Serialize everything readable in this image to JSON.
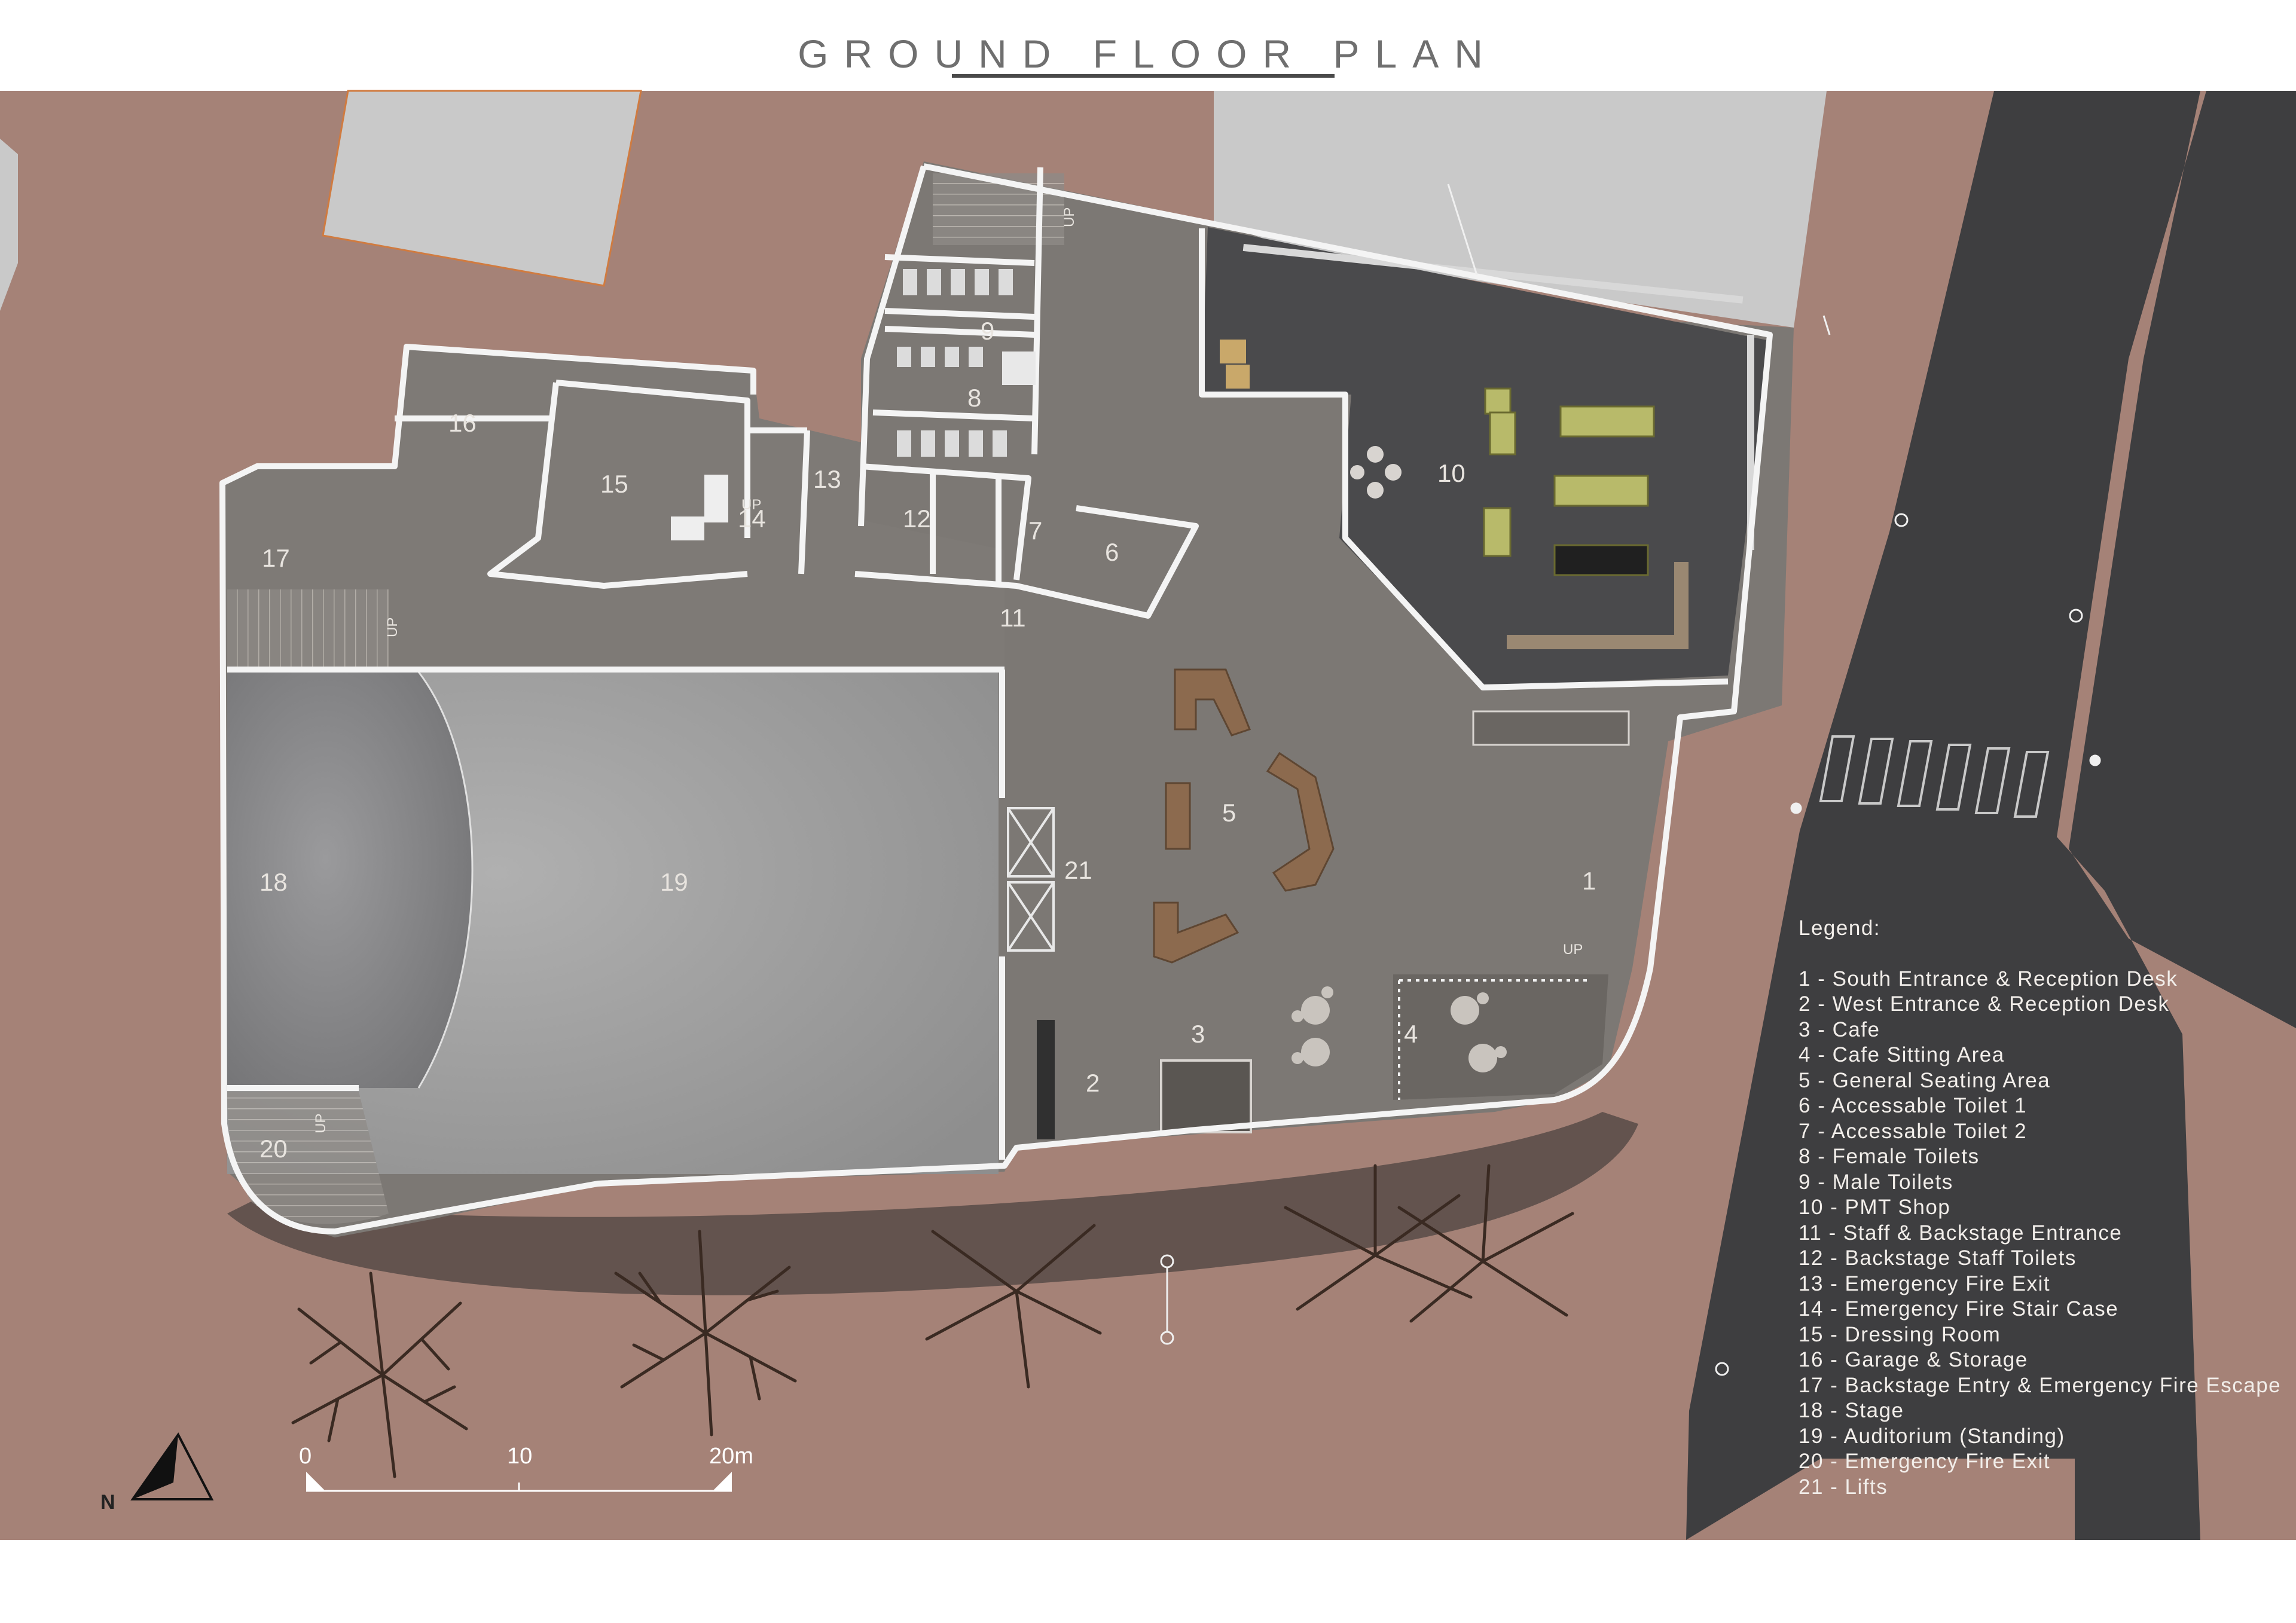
{
  "title": "GROUND FLOOR PLAN",
  "colors": {
    "ground": "#a58277",
    "floor": "#7c7874",
    "shop": "#4a4a4c",
    "auditorium": "#a8a8a8",
    "road": "#3e3e40",
    "building_grey": "#c9c9c9",
    "wall": "#f4f4f4",
    "furniture": "#8c6a4e",
    "sofa": "#b8ba6a"
  },
  "rooms": [
    {
      "num": "1"
    },
    {
      "num": "2"
    },
    {
      "num": "3"
    },
    {
      "num": "4"
    },
    {
      "num": "5"
    },
    {
      "num": "6"
    },
    {
      "num": "7"
    },
    {
      "num": "8"
    },
    {
      "num": "9"
    },
    {
      "num": "10"
    },
    {
      "num": "11"
    },
    {
      "num": "12"
    },
    {
      "num": "13"
    },
    {
      "num": "14"
    },
    {
      "num": "15"
    },
    {
      "num": "16"
    },
    {
      "num": "17"
    },
    {
      "num": "18"
    },
    {
      "num": "19"
    },
    {
      "num": "20"
    },
    {
      "num": "21"
    }
  ],
  "stair_label": "UP",
  "legend": {
    "title": "Legend:",
    "items": [
      "1 - South Entrance & Reception Desk",
      "2 - West Entrance & Reception Desk",
      "3 - Cafe",
      "4 - Cafe Sitting Area",
      "5 - General Seating Area",
      "6 - Accessable Toilet 1",
      "7 - Accessable Toilet 2",
      "8 - Female Toilets",
      "9 - Male Toilets",
      "10 - PMT Shop",
      "11 - Staff & Backstage Entrance",
      "12 - Backstage Staff Toilets",
      "13 - Emergency Fire Exit",
      "14 - Emergency Fire Stair Case",
      "15 - Dressing Room",
      "16 - Garage & Storage",
      "17 - Backstage Entry & Emergency Fire Escape",
      "18 - Stage",
      "19 - Auditorium (Standing)",
      "20 - Emergency Fire Exit",
      "21 - Lifts"
    ]
  },
  "scale_bar": {
    "ticks": [
      "0",
      "10",
      "20m"
    ]
  },
  "north": {
    "label": "N",
    "icon": "north-arrow-icon"
  }
}
